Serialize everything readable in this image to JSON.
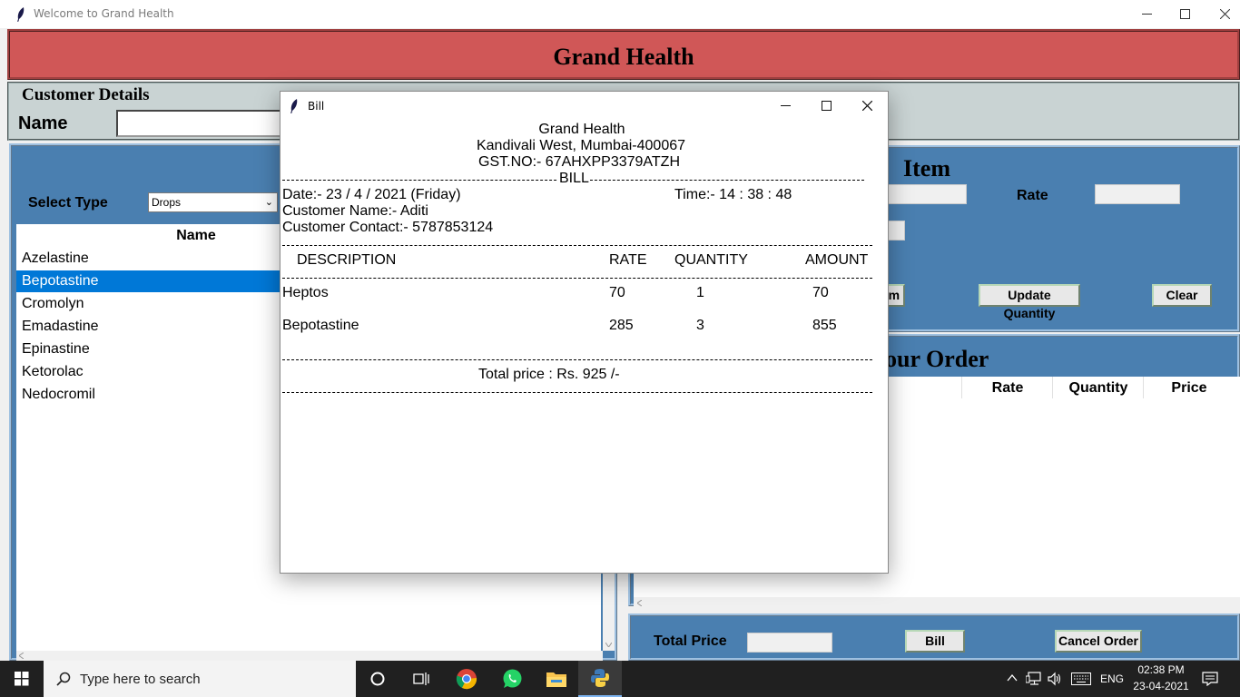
{
  "window": {
    "title": "Welcome to Grand Health"
  },
  "header": {
    "title": "Grand Health"
  },
  "customer_details": {
    "legend": "Customer Details",
    "name_label": "Name",
    "name_value": ""
  },
  "medicine_panel": {
    "select_label": "Select Type",
    "selected_type": "Drops",
    "column_header": "Name",
    "items": [
      "Azelastine",
      "Bepotastine",
      "Cromolyn",
      "Emadastine",
      "Epinastine",
      "Ketorolac",
      "Nedocromil"
    ],
    "selected_item": "Bepotastine"
  },
  "item_panel": {
    "title": "Item",
    "rate_label": "Rate",
    "add_item_button_partial": "em",
    "update_quantity_button": "Update Quantity",
    "clear_button": "Clear"
  },
  "order_panel": {
    "title_partial": "our Order",
    "columns": [
      "Rate",
      "Quantity",
      "Price"
    ]
  },
  "total_bar": {
    "total_label": "Total Price",
    "bill_button": "Bill",
    "cancel_order_button": "Cancel Order"
  },
  "bill_dialog": {
    "title": "Bill",
    "shop_name": "Grand Health",
    "address": "Kandivali West, Mumbai-400067",
    "gst": "GST.NO:- 67AHXPP3379ATZH",
    "bill_heading": "BILL",
    "date": "Date:- 23 / 4 / 2021 (Friday)",
    "time": "Time:- 14 : 38 : 48",
    "customer_name": "Customer Name:- Aditi",
    "customer_contact": "Customer Contact:- 5787853124",
    "columns": {
      "description": "DESCRIPTION",
      "rate": "RATE",
      "quantity": "QUANTITY",
      "amount": "AMOUNT"
    },
    "rows": [
      {
        "description": "Heptos",
        "rate": "70",
        "quantity": "1",
        "amount": "70"
      },
      {
        "description": "Bepotastine",
        "rate": "285",
        "quantity": "3",
        "amount": "855"
      }
    ],
    "total": "Total price : Rs. 925  /-"
  },
  "taskbar": {
    "search_placeholder": "Type here to search",
    "language": "ENG",
    "clock_time": "02:38 PM",
    "clock_date": "23-04-2021"
  }
}
